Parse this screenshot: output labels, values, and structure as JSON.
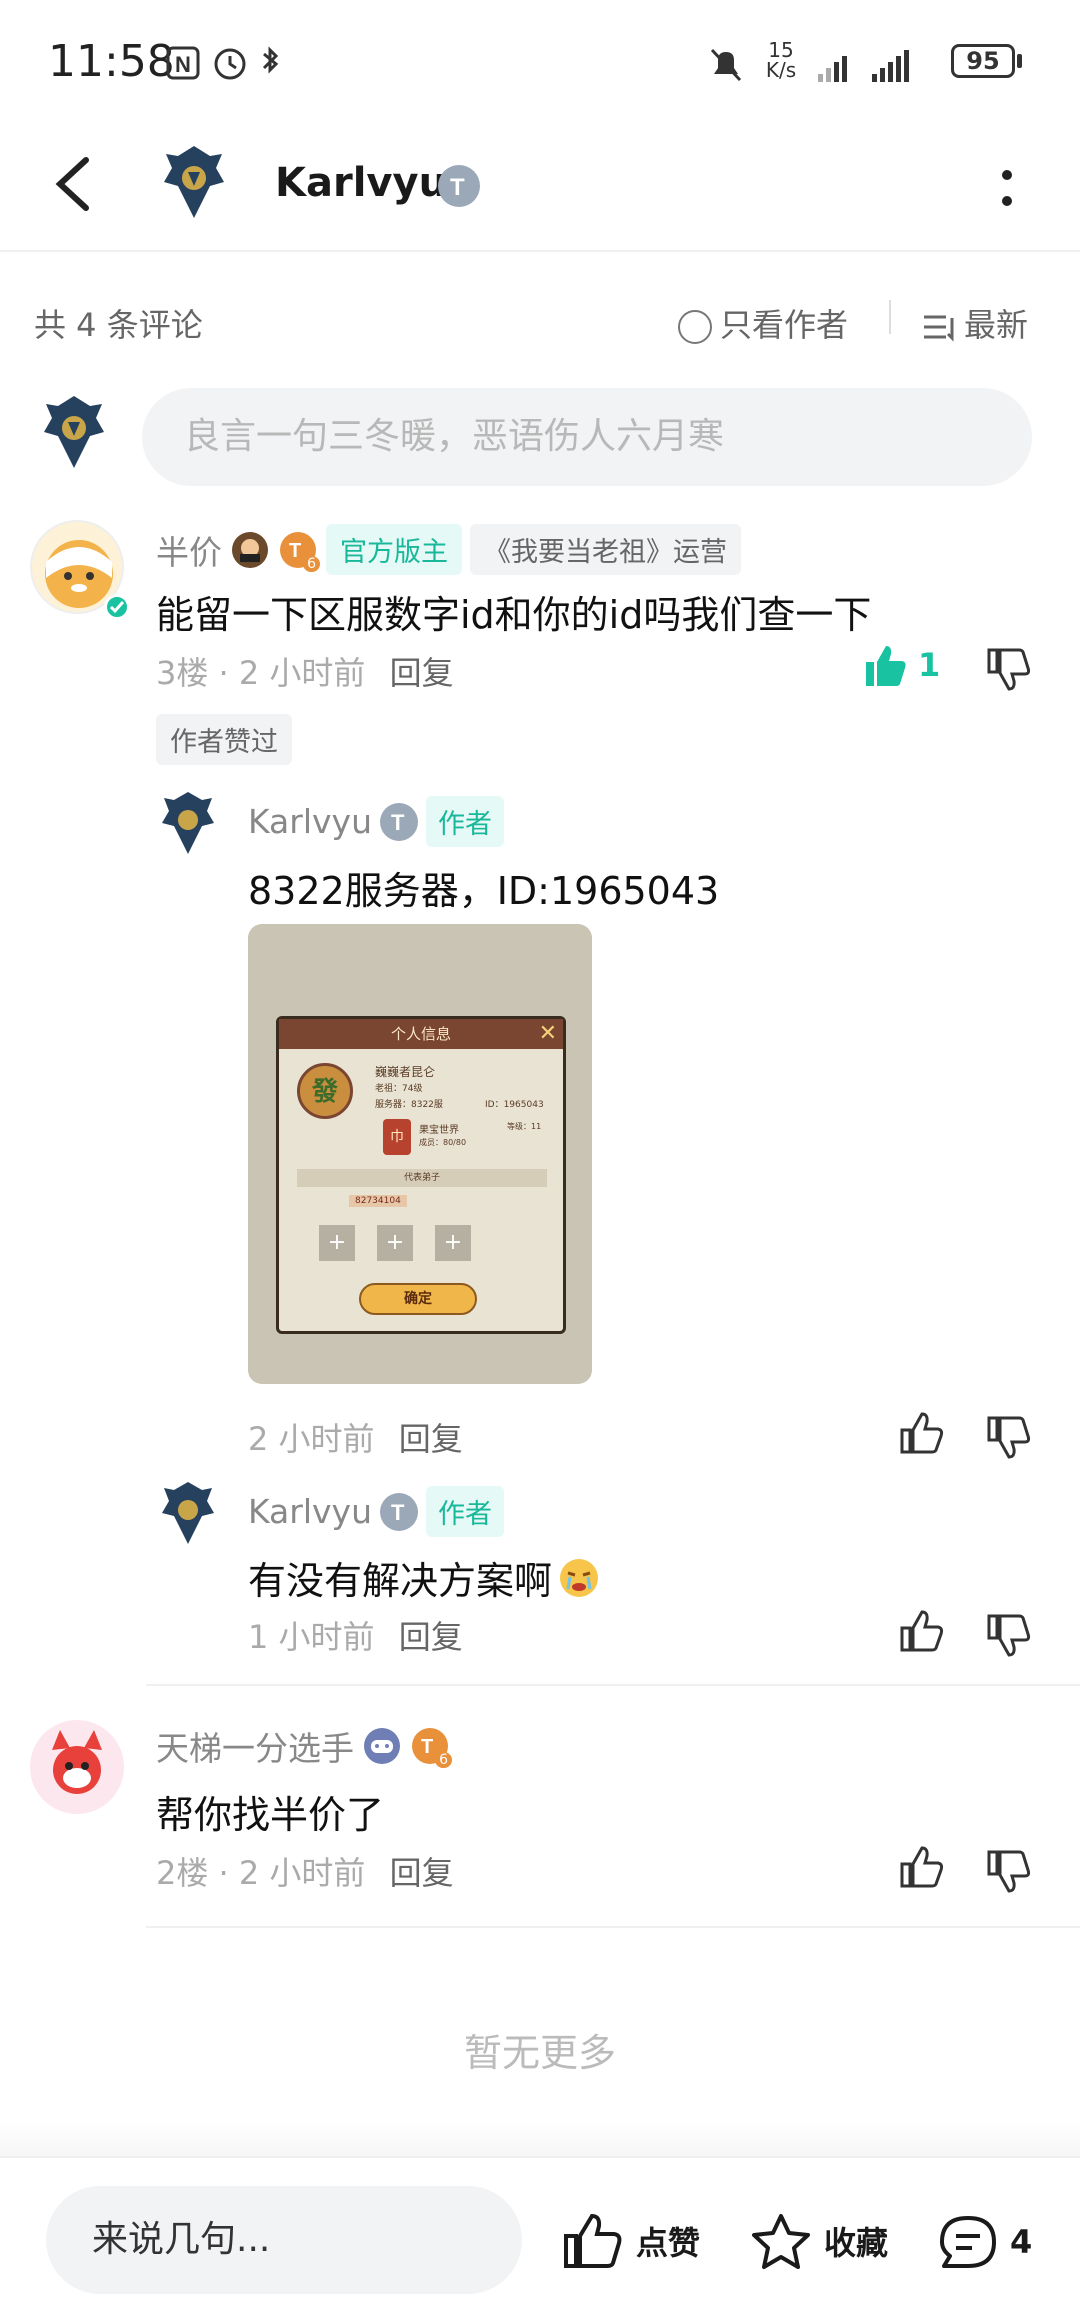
{
  "status_bar": {
    "time": "11:58",
    "net_speed_top": "15",
    "net_speed_bottom": "K/s",
    "battery": "95"
  },
  "header": {
    "title": "Karlvyu"
  },
  "comments_header": {
    "count_label": "共 4 条评论",
    "only_author": "只看作者",
    "sort": "最新"
  },
  "input": {
    "placeholder": "良言一句三冬暖，恶语伤人六月寒"
  },
  "comments": [
    {
      "name": "半价",
      "level": "6",
      "tag_official": "官方版主",
      "tag_game": "《我要当老祖》运营",
      "content": "能留一下区服数字id和你的id吗我们查一下",
      "floor": "3楼",
      "time": "2 小时前",
      "reply_label": "回复",
      "likes": "1",
      "author_liked": "作者赞过",
      "replies": [
        {
          "name": "Karlvyu",
          "tag_author": "作者",
          "content": "8322服务器，ID:1965043",
          "time": "2 小时前",
          "reply_label": "回复",
          "image": {
            "dialog_title": "个人信息",
            "player_name": "巍巍者昆仑",
            "player_level": "老祖：74级",
            "server": "服务器：8322服",
            "player_id": "ID：1965043",
            "sect": "果宝世界",
            "sect_level": "等级：11",
            "members": "成员：80/80",
            "avatar_char": "發",
            "badge_char": "巾",
            "section_label": "代表弟子",
            "power": "82734104",
            "confirm": "确定"
          }
        },
        {
          "name": "Karlvyu",
          "tag_author": "作者",
          "content": "有没有解决方案啊",
          "time": "1 小时前",
          "reply_label": "回复"
        }
      ]
    },
    {
      "name": "天梯一分选手",
      "level": "6",
      "content": "帮你找半价了",
      "floor": "2楼",
      "time": "2 小时前",
      "reply_label": "回复"
    }
  ],
  "no_more": "暂无更多",
  "bottom_bar": {
    "input_placeholder": "来说几句...",
    "like_label": "点赞",
    "favorite_label": "收藏",
    "comment_count": "4"
  },
  "colors": {
    "accent": "#19c2a0",
    "text": "#111111",
    "muted": "#aaaaaa"
  }
}
